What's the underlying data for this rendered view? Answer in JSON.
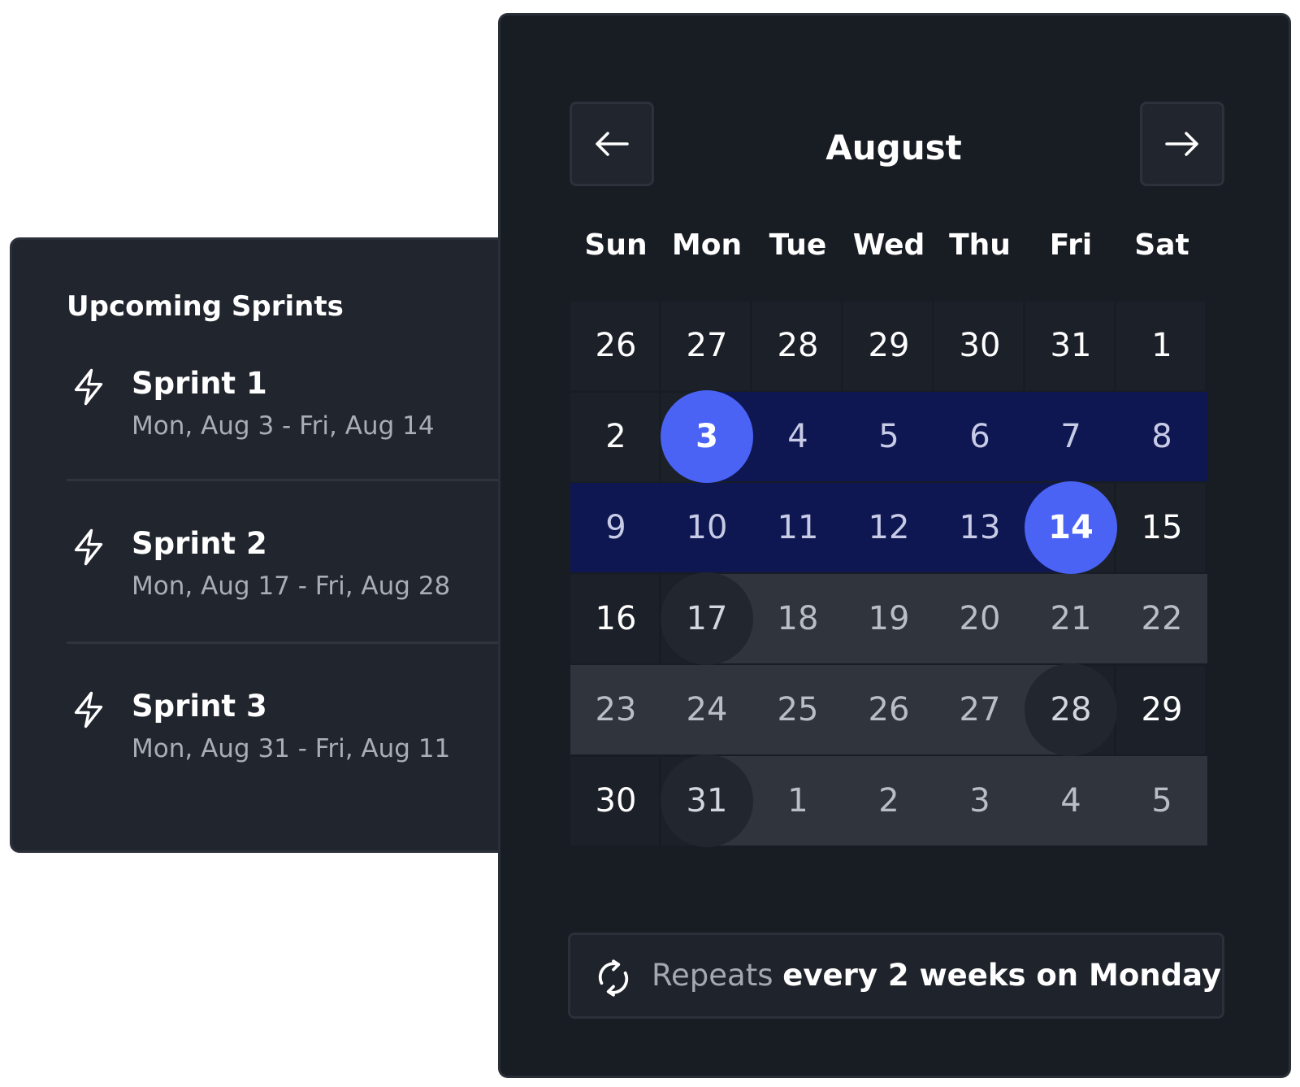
{
  "sprints_panel": {
    "title": "Upcoming Sprints",
    "items": [
      {
        "name": "Sprint 1",
        "range": "Mon, Aug 3 - Fri, Aug 14"
      },
      {
        "name": "Sprint 2",
        "range": "Mon, Aug 17 - Fri, Aug 28"
      },
      {
        "name": "Sprint 3",
        "range": "Mon, Aug 31 - Fri, Aug 11"
      }
    ]
  },
  "calendar": {
    "month": "August",
    "prev_icon": "arrow-left-icon",
    "next_icon": "arrow-right-icon",
    "weekdays": [
      "Sun",
      "Mon",
      "Tue",
      "Wed",
      "Thu",
      "Fri",
      "Sat"
    ],
    "weeks": [
      [
        "26",
        "27",
        "28",
        "29",
        "30",
        "31",
        "1"
      ],
      [
        "2",
        "3",
        "4",
        "5",
        "6",
        "7",
        "8"
      ],
      [
        "9",
        "10",
        "11",
        "12",
        "13",
        "14",
        "15"
      ],
      [
        "16",
        "17",
        "18",
        "19",
        "20",
        "21",
        "22"
      ],
      [
        "23",
        "24",
        "25",
        "26",
        "27",
        "28",
        "29"
      ],
      [
        "30",
        "31",
        "1",
        "2",
        "3",
        "4",
        "5"
      ]
    ],
    "selected_range": {
      "start": "3",
      "end": "14"
    },
    "upcoming_sprint_starts": [
      "17",
      "31"
    ],
    "upcoming_sprint_ends": [
      "28"
    ],
    "colors": {
      "selected": "#4a63f5",
      "current_sprint_band": "#0e1752",
      "future_sprint_band": "#2f343d"
    }
  },
  "repeat": {
    "icon": "repeat-icon",
    "prefix": "Repeats",
    "rule": "every 2 weeks on Monday"
  }
}
